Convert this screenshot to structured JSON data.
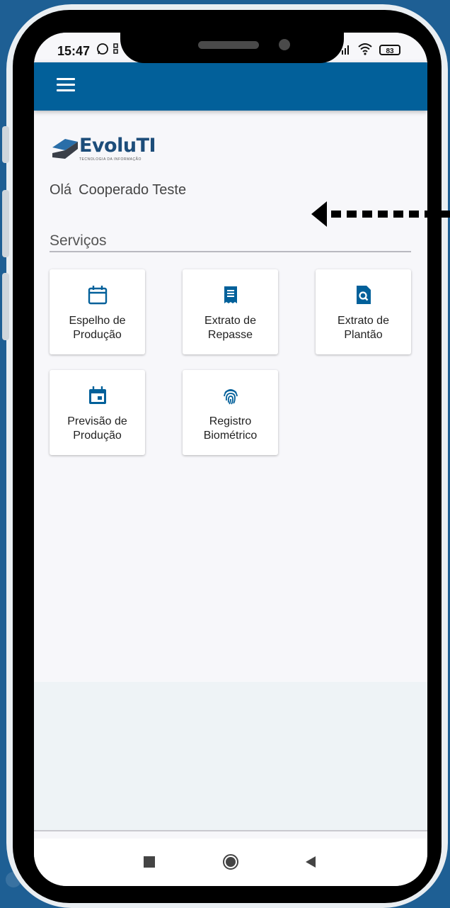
{
  "status_bar": {
    "time": "15:47",
    "battery": "83",
    "icons": [
      "whatsapp-icon",
      "grid-icon",
      "signal-icon",
      "wifi-icon",
      "battery-icon"
    ]
  },
  "app_bar": {
    "menu_icon": "hamburger-menu-icon",
    "color": "#02609a"
  },
  "logo": {
    "text": "EvoluTI",
    "subtitle": "TECNOLOGIA DA INFORMAÇÃO"
  },
  "greeting": {
    "prefix": "Olá",
    "name": "Cooperado Teste"
  },
  "services": {
    "title": "Serviços",
    "items": [
      {
        "label": "Espelho de Produção",
        "icon": "calendar-outline-icon"
      },
      {
        "label": "Extrato de Repasse",
        "icon": "receipt-icon"
      },
      {
        "label": "Extrato de Plantão",
        "icon": "document-search-icon"
      },
      {
        "label": "Previsão de Produção",
        "icon": "calendar-event-icon"
      },
      {
        "label": "Registro Biométrico",
        "icon": "fingerprint-icon"
      }
    ]
  },
  "nav_bar": {
    "buttons": [
      "recent-apps-square-icon",
      "home-circle-icon",
      "back-triangle-icon"
    ]
  },
  "colors": {
    "accent": "#02609a",
    "background": "#1e5f94"
  }
}
